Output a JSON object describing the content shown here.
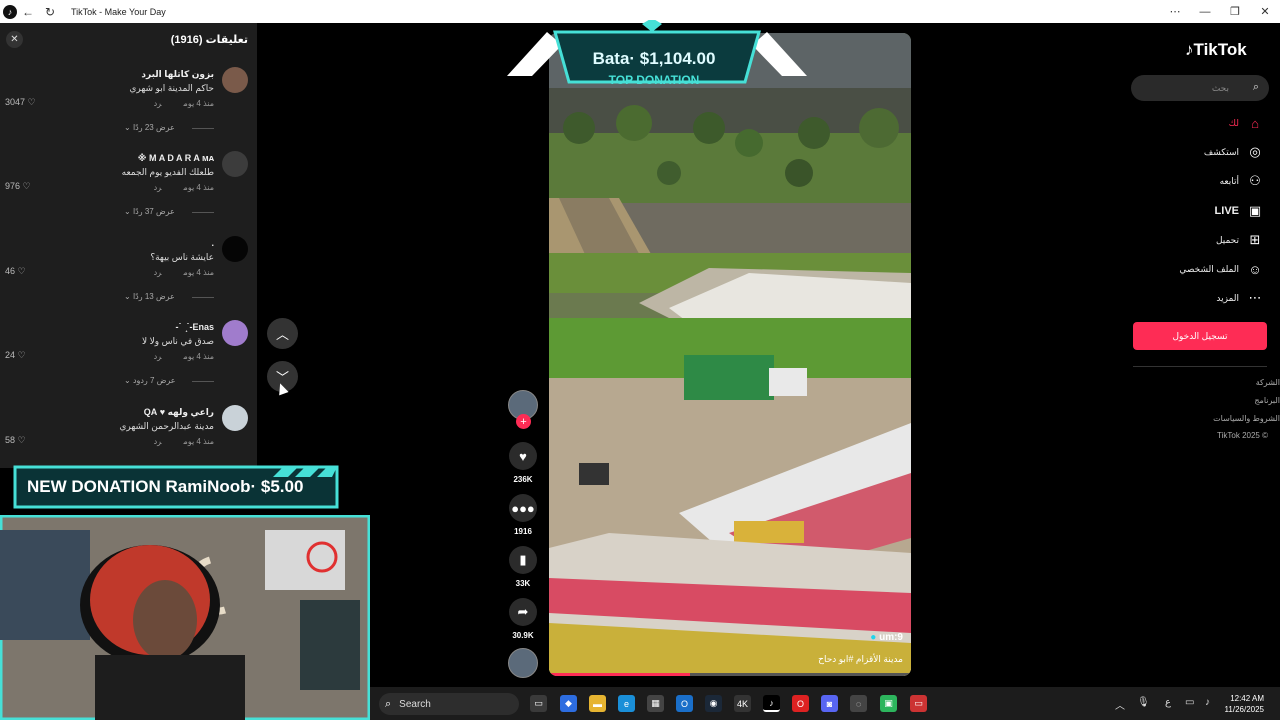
{
  "window": {
    "title": "TikTok - Make Your Day"
  },
  "comments_panel": {
    "header": "تعليقات (1916)",
    "items": [
      {
        "name": "بزون كاتلها البرد",
        "text": "حاكم المدينة ابو شهري",
        "time": "منذ 4 يوم",
        "reply": "رد",
        "likes": "3047",
        "replies": "عرض 23 ردًا"
      },
      {
        "name": "M A D A R A ᴍᴀ ※",
        "text": "طلعلك الفديو يوم الجمعه",
        "time": "منذ 4 يوم",
        "reply": "رد",
        "likes": "976",
        "replies": "عرض 37 ردًا"
      },
      {
        "name": ".",
        "text": "عايشة ناس بيهة؟",
        "time": "منذ 4 يوم",
        "reply": "رد",
        "likes": "46",
        "replies": "عرض 13 ردًا"
      },
      {
        "name": "Enas-˙ ̟ ˙-",
        "text": "صدق في ناس ولا لا",
        "time": "منذ 4 يوم",
        "reply": "رد",
        "likes": "24",
        "replies": "عرض 7 ردود"
      },
      {
        "name": "راعي ولهه ♥ QA",
        "text": "مدينة عبدالرحمن الشهري",
        "time": "منذ 4 يوم",
        "reply": "رد",
        "likes": "58",
        "replies": ""
      }
    ]
  },
  "video": {
    "top_donation": {
      "amount": "Bata· $1,104.00",
      "label": "TOP DONATION"
    },
    "author": "um:9",
    "caption": "مدينة الأقزام #ابو دحاح",
    "progress": 0.39
  },
  "actions": {
    "likes": "236K",
    "comments": "1916",
    "saves": "33K",
    "shares": "30.9K"
  },
  "new_donation": {
    "text": "NEW DONATION RamiNoob· $5.00"
  },
  "sidebar": {
    "logo": "TikTok",
    "search_placeholder": "بحث",
    "nav": [
      {
        "label": "لك",
        "icon": "home-icon",
        "active": true
      },
      {
        "label": "استكشف",
        "icon": "compass-icon"
      },
      {
        "label": "أتابعه",
        "icon": "user-plus-icon"
      },
      {
        "label": "LIVE",
        "icon": "live-icon"
      },
      {
        "label": "تحميل",
        "icon": "upload-icon"
      },
      {
        "label": "الملف الشخصي",
        "icon": "profile-icon"
      },
      {
        "label": "المزيد",
        "icon": "more-icon"
      }
    ],
    "login": "تسجيل الدخول",
    "footer": [
      "الشركة",
      "البرنامج",
      "الشروط والسياسات",
      "© 2025 TikTok"
    ]
  },
  "taskbar": {
    "search": "Search",
    "time": "12:42 AM",
    "date": "11/26/2025",
    "lang": "ع"
  },
  "colors": {
    "accent": "#fe2c55",
    "banner": "#46e0d7"
  }
}
